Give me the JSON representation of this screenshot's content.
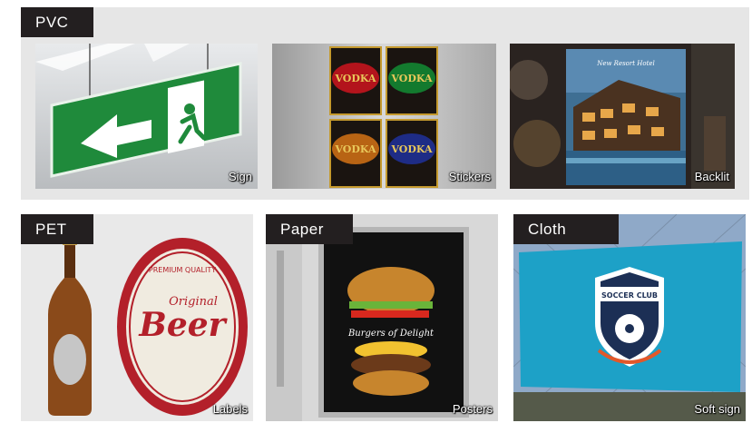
{
  "groups": {
    "pvc": {
      "tag": "PVC",
      "items": [
        {
          "caption": "Sign",
          "icon": "exit-sign-icon"
        },
        {
          "caption": "Stickers",
          "sticker_text": "VODKA"
        },
        {
          "caption": "Backlit",
          "poster_text": "New Resort Hotel"
        }
      ]
    },
    "pet": {
      "tag": "PET",
      "items": [
        {
          "caption": "Labels",
          "label_top": "PREMIUM QUALITY",
          "label_script": "Original",
          "label_main": "Beer"
        }
      ]
    },
    "paper": {
      "tag": "Paper",
      "items": [
        {
          "caption": "Posters",
          "poster_script": "Burgers of Delight"
        }
      ]
    },
    "cloth": {
      "tag": "Cloth",
      "items": [
        {
          "caption": "Soft sign",
          "badge_text": "SOCCER CLUB"
        }
      ]
    }
  },
  "colors": {
    "tag_bg": "#231f20",
    "section_bg": "#e6e6e6",
    "caption": "#ffffff"
  }
}
